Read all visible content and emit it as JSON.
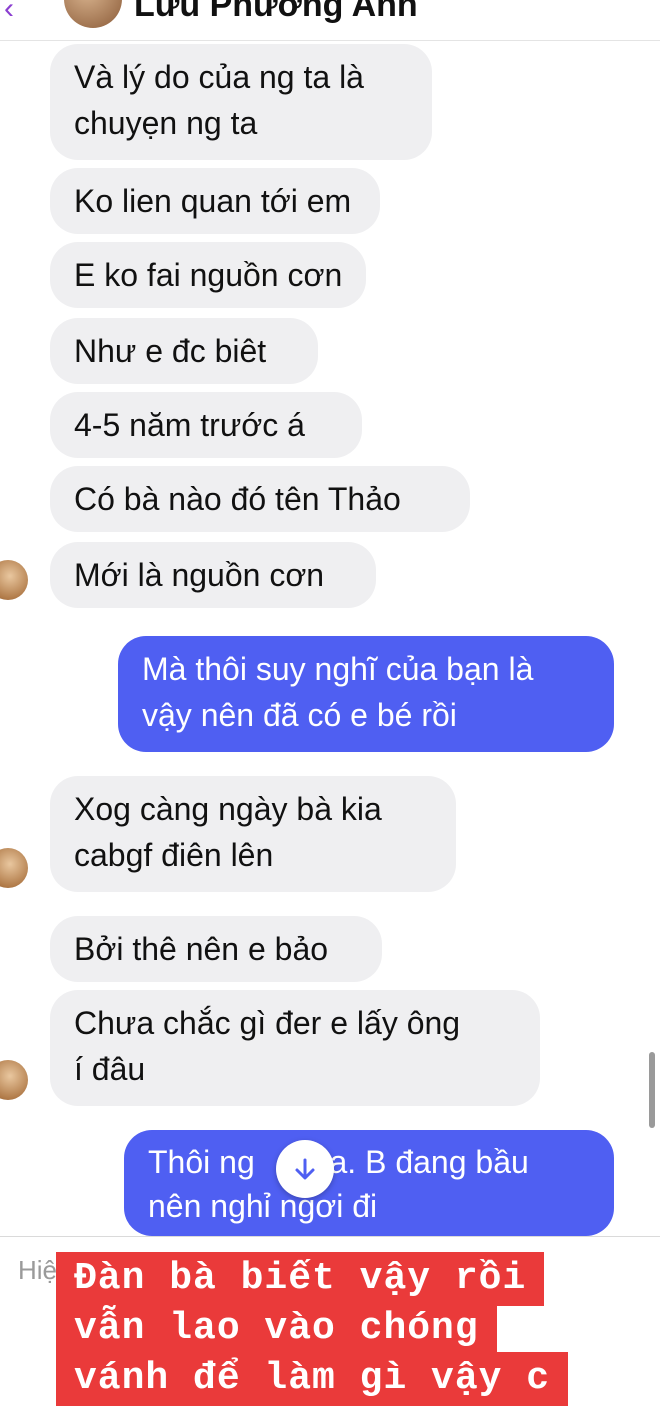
{
  "header": {
    "back_icon": "chevron-left-icon",
    "contact_name": "Lưu Phương Anh"
  },
  "messages": [
    {
      "side": "in",
      "text": "Và lý do của ng ta là\nchuyẹn ng ta"
    },
    {
      "side": "in",
      "text": "Ko lien quan tới em"
    },
    {
      "side": "in",
      "text": "E ko fai nguồn cơn"
    },
    {
      "side": "in",
      "text": "Như e đc biêt"
    },
    {
      "side": "in",
      "text": "4-5 năm trước á"
    },
    {
      "side": "in",
      "text": "Có bà nào đó tên Thảo"
    },
    {
      "side": "in",
      "text": "Mới là nguồn cơn"
    },
    {
      "side": "out",
      "text": "Mà thôi suy nghĩ của bạn là\nvậy nên đã có e bé rồi"
    },
    {
      "side": "in",
      "text": "Xog càng ngày bà kia\ncabgf điên lên"
    },
    {
      "side": "in",
      "text": "Bởi thê nên e bảo"
    },
    {
      "side": "in",
      "text": "Chưa chắc gì đer e lấy ông\ní đâu"
    },
    {
      "side": "out",
      "text": "Thôi ng      ưa. B đang bầu\nnên nghỉ ngơi đi"
    }
  ],
  "composer": {
    "placeholder": "Hiệ"
  },
  "caption": {
    "line1": "Đàn bà biết vậy rồi",
    "line2": "vẫn lao vào chóng",
    "line3": "vánh để làm gì vậy c"
  },
  "colors": {
    "incoming_bubble": "#efeff1",
    "outgoing_bubble": "#4f5ff2",
    "caption_background": "#ea3a3a",
    "accent": "#8b3fd0"
  }
}
